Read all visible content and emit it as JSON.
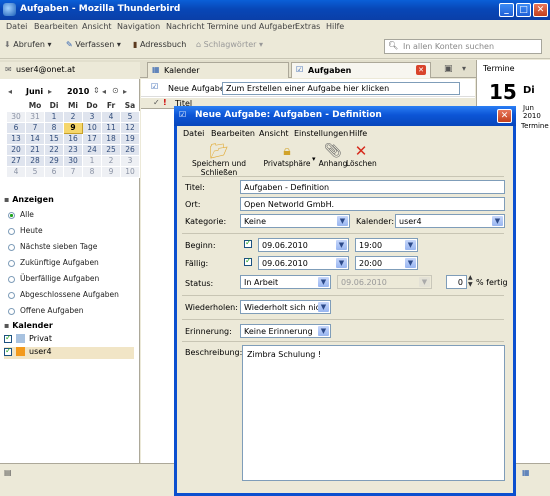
{
  "window": {
    "title": "Aufgaben - Mozilla Thunderbird"
  },
  "menubar": [
    "Datei",
    "Bearbeiten",
    "Ansicht",
    "Navigation",
    "Nachricht",
    "Termine und Aufgaben",
    "Extras",
    "Hilfe"
  ],
  "toolbar": {
    "abrufen": "Abrufen",
    "verfassen": "Verfassen",
    "adressbuch": "Adressbuch",
    "schlagwoerter": "Schlagwörter",
    "search_placeholder": "In allen Konten suchen"
  },
  "tabs": {
    "account": "user4@onet.at",
    "kalender": "Kalender",
    "aufgaben": "Aufgaben",
    "termine": "Termine"
  },
  "minicalendar": {
    "month": "Juni",
    "year": "2010",
    "weekdays": [
      "Mo",
      "Di",
      "Mi",
      "Do",
      "Fr",
      "Sa"
    ],
    "weeks": [
      [
        "31",
        "1",
        "2",
        "3",
        "4",
        "5"
      ],
      [
        "7",
        "8",
        "9",
        "10",
        "11",
        "12"
      ],
      [
        "14",
        "15",
        "16",
        "17",
        "18",
        "19"
      ],
      [
        "21",
        "22",
        "23",
        "24",
        "25",
        "26"
      ],
      [
        "28",
        "29",
        "30",
        "1",
        "2",
        "3"
      ],
      [
        "5",
        "6",
        "7",
        "8",
        "9",
        "10"
      ]
    ],
    "left_column": [
      "30",
      "6",
      "13",
      "20",
      "27",
      "4"
    ]
  },
  "anzeigen": {
    "title": "Anzeigen",
    "options": [
      "Alle",
      "Heute",
      "Nächste sieben Tage",
      "Zukünftige Aufgaben",
      "Überfällige Aufgaben",
      "Abgeschlossene Aufgaben",
      "Offene Aufgaben"
    ]
  },
  "kalender": {
    "title": "Kalender",
    "items": [
      "Privat",
      "user4"
    ]
  },
  "tasklist": {
    "new_label": "Neue Aufgabe",
    "new_placeholder": "Zum Erstellen einer Aufgabe hier klicken",
    "col_title": "Titel"
  },
  "right": {
    "day": "15",
    "weekday": "Di",
    "monthyear": "Jun 2010",
    "header": "Termine"
  },
  "dialog": {
    "title": "Neue Aufgabe: Aufgaben - Definition",
    "menu": [
      "Datei",
      "Bearbeiten",
      "Ansicht",
      "Einstellungen",
      "Hilfe"
    ],
    "tools": {
      "save": "Speichern und Schließen",
      "privacy": "Privatsphäre",
      "attach": "Anhang",
      "delete": "Löschen"
    },
    "labels": {
      "titel": "Titel:",
      "ort": "Ort:",
      "kategorie": "Kategorie:",
      "kalender": "Kalender:",
      "beginn": "Beginn:",
      "faellig": "Fällig:",
      "status": "Status:",
      "prozent": "% fertig",
      "wiederholen": "Wiederholen:",
      "erinnerung": "Erinnerung:",
      "beschreibung": "Beschreibung:"
    },
    "values": {
      "titel": "Aufgaben - Definition",
      "ort": "Open Networld GmbH.",
      "kategorie": "Keine",
      "kalender": "user4",
      "beginn_date": "09.06.2010",
      "beginn_time": "19:00",
      "faellig_date": "09.06.2010",
      "faellig_time": "20:00",
      "status": "In Arbeit",
      "status_date": "09.06.2010",
      "prozent": "0",
      "wiederholen": "Wiederholt sich nicht",
      "erinnerung": "Keine Erinnerung",
      "beschreibung": "Zimbra Schulung !"
    }
  }
}
